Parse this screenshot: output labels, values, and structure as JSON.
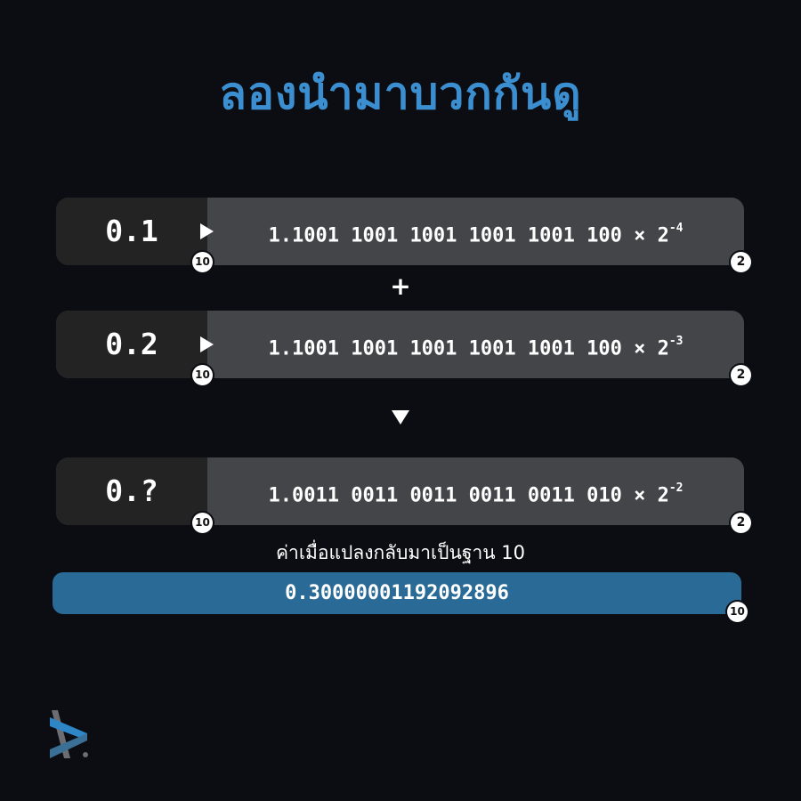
{
  "title": "ลองนำมาบวกกันดู",
  "rows": [
    {
      "decimal": "0.1",
      "binary": "1.1001 1001 1001 1001 1001 100 × 2",
      "exponent": "-4",
      "left_base": "10",
      "right_base": "2"
    },
    {
      "decimal": "0.2",
      "binary": "1.1001 1001 1001 1001 1001 100 × 2",
      "exponent": "-3",
      "left_base": "10",
      "right_base": "2"
    },
    {
      "decimal": "0.?",
      "binary": "1.0011 0011 0011 0011 0011 010 × 2",
      "exponent": "-2",
      "left_base": "10",
      "right_base": "2"
    }
  ],
  "operator": "+",
  "caption": "ค่าเมื่อแปลงกลับมาเป็นฐาน 10",
  "result": {
    "value": "0.30000001192092896",
    "base": "10"
  },
  "colors": {
    "title": "#3b8fd0",
    "background": "#0b0d12",
    "row_left": "#232324",
    "row_right": "#444548",
    "result_bar": "#2a6a96"
  },
  "icons": [
    "play-arrow-icon",
    "down-arrow-icon",
    "brand-logo-icon"
  ]
}
